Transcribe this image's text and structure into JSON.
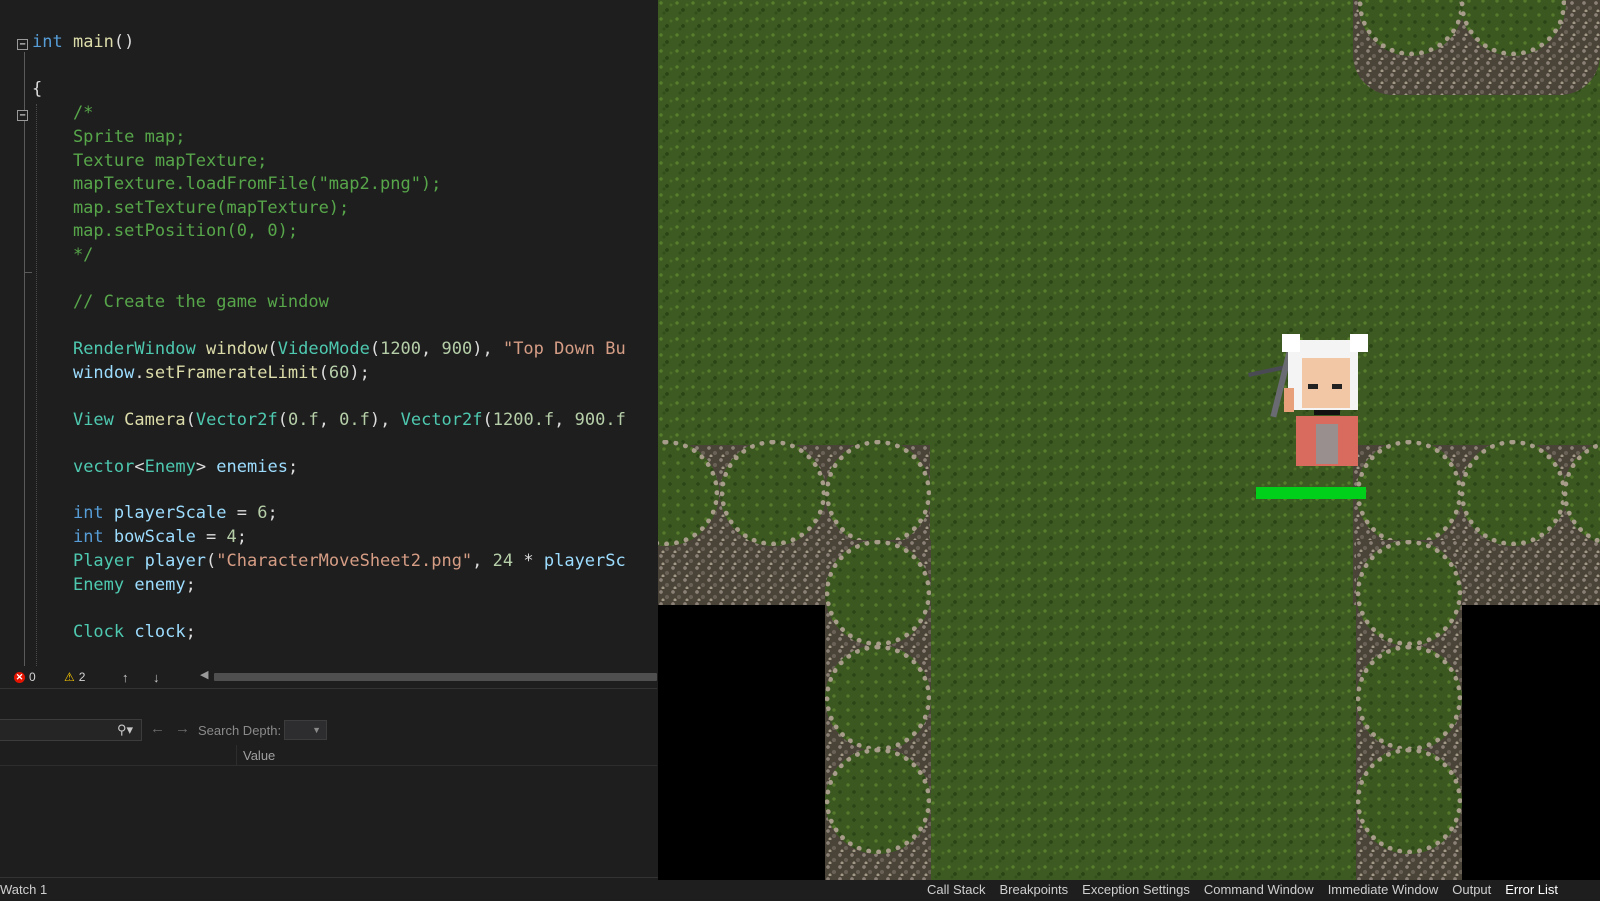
{
  "editor": {
    "code_lines": [
      "int main()",
      "",
      "{",
      "    /*",
      "    Sprite map;",
      "    Texture mapTexture;",
      "    mapTexture.loadFromFile(\"map2.png\");",
      "    map.setTexture(mapTexture);",
      "    map.setPosition(0, 0);",
      "    */",
      "",
      "    // Create the game window",
      "",
      "    RenderWindow window(VideoMode(1200, 900), \"Top Down Bu",
      "    window.setFramerateLimit(60);",
      "",
      "    View Camera(Vector2f(0.f, 0.f), Vector2f(1200.f, 900.f",
      "",
      "    vector<Enemy> enemies;",
      "",
      "    int playerScale = 6;",
      "    int bowScale = 4;",
      "    Player player(\"CharacterMoveSheet2.png\", 24 * playerSc",
      "    Enemy enemy;",
      "",
      "    Clock clock;"
    ]
  },
  "status": {
    "errors": "0",
    "warnings": "2",
    "error_icon": "error-icon",
    "warning_icon": "warning-icon",
    "next_icon": "arrow-up-icon",
    "prev_icon": "arrow-down-icon"
  },
  "watch": {
    "search_depth_label": "Search Depth:",
    "column_value": "Value",
    "tab_label": "Watch 1"
  },
  "bottom_tabs": [
    "Call Stack",
    "Breakpoints",
    "Exception Settings",
    "Command Window",
    "Immediate Window",
    "Output",
    "Error List"
  ],
  "active_bottom_tab": "Error List",
  "game": {
    "health": 1.0,
    "colors": {
      "grass": "#3d5a22",
      "void": "#000000",
      "health_bar": "#00d01a",
      "stone": "#a79d8a"
    }
  }
}
